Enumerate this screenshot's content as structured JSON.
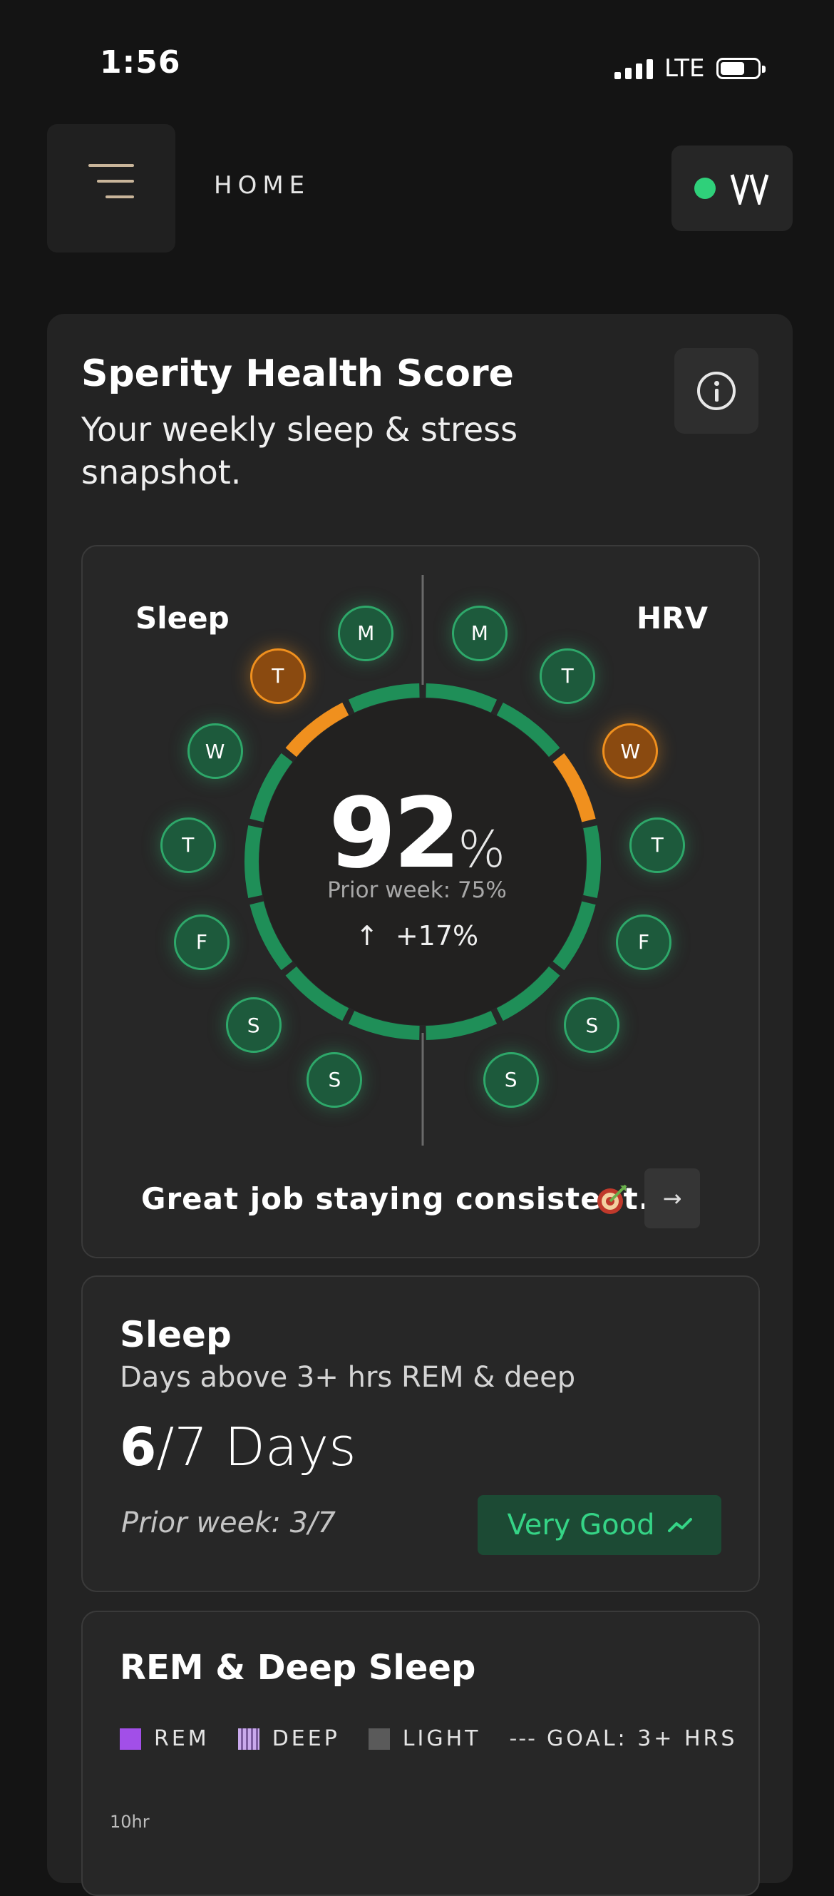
{
  "status_bar": {
    "time": "1:56",
    "network": "LTE"
  },
  "header": {
    "title": "HOME",
    "logo_text": "\\/\\/"
  },
  "score_card": {
    "title": "Sperity Health Score",
    "subtitle": "Your weekly sleep & stress snapshot.",
    "sleep_label": "Sleep",
    "hrv_label": "HRV",
    "score_value": "92",
    "score_unit": "%",
    "prior_week": "Prior week: 75%",
    "change_arrow": "↑",
    "change": "+17%",
    "message": "Great job staying consistent.",
    "arrow": "→",
    "sleep_days": [
      {
        "label": "M",
        "status": "good"
      },
      {
        "label": "T",
        "status": "warn"
      },
      {
        "label": "W",
        "status": "good"
      },
      {
        "label": "T",
        "status": "good"
      },
      {
        "label": "F",
        "status": "good"
      },
      {
        "label": "S",
        "status": "good"
      },
      {
        "label": "S",
        "status": "good"
      }
    ],
    "hrv_days": [
      {
        "label": "M",
        "status": "good"
      },
      {
        "label": "T",
        "status": "good"
      },
      {
        "label": "W",
        "status": "warn"
      },
      {
        "label": "T",
        "status": "good"
      },
      {
        "label": "F",
        "status": "good"
      },
      {
        "label": "S",
        "status": "good"
      },
      {
        "label": "S",
        "status": "good"
      }
    ],
    "colors": {
      "good": "#2ea86a",
      "warn": "#f0901e",
      "ring_track": "#1f8f58"
    }
  },
  "sleep_card": {
    "title": "Sleep",
    "subtitle": "Days above 3+ hrs REM & deep",
    "days_bold": "6",
    "days_rest": "/7 Days",
    "prior": "Prior week: 3/7",
    "badge": "Very Good",
    "badge_icon": "trend-up-icon"
  },
  "rem_card": {
    "title": "REM & Deep Sleep",
    "legend": {
      "rem": "REM",
      "deep": "DEEP",
      "light": "LIGHT",
      "goal_dash": "---",
      "goal": "GOAL: 3+ HRS"
    },
    "colors": {
      "rem": "#a24fe8",
      "deep": "#c9a9ec",
      "light": "#5a5a5a"
    },
    "y_tick_top": "10hr"
  }
}
